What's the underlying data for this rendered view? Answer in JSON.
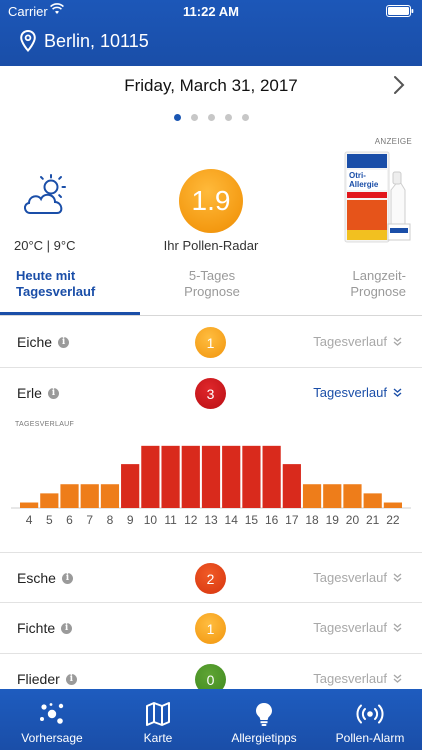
{
  "status_bar": {
    "carrier": "Carrier",
    "time": "11:22 AM"
  },
  "location": {
    "label": "Berlin, 10115"
  },
  "date": {
    "label": "Friday, March 31, 2017",
    "page_dots": 5,
    "active_dot": 0
  },
  "weather": {
    "temperature": "20°C | 9°C",
    "icon": "partly-cloudy-icon"
  },
  "radar": {
    "value": "1.9",
    "label": "Ihr Pollen-Radar"
  },
  "ad": {
    "label": "ANZEIGE",
    "product": "Otri-Allergie"
  },
  "tabs": [
    {
      "line1": "Heute mit",
      "line2": "Tagesverlauf",
      "active": true
    },
    {
      "line1": "5-Tages",
      "line2": "Prognose",
      "active": false
    },
    {
      "line1": "Langzeit-",
      "line2": "Prognose",
      "active": false
    }
  ],
  "pollen": [
    {
      "name": "Eiche",
      "level": "1",
      "link": "Tagesverlauf"
    },
    {
      "name": "Erle",
      "level": "3",
      "link": "Tagesverlauf"
    },
    {
      "name": "Esche",
      "level": "2",
      "link": "Tagesverlauf"
    },
    {
      "name": "Fichte",
      "level": "1",
      "link": "Tagesverlauf"
    },
    {
      "name": "Flieder",
      "level": "0",
      "link": "Tagesverlauf"
    }
  ],
  "chart_data": {
    "type": "bar",
    "title": "TAGESVERLAUF",
    "categories": [
      "4",
      "5",
      "6",
      "7",
      "8",
      "9",
      "10",
      "11",
      "12",
      "13",
      "14",
      "15",
      "16",
      "17",
      "18",
      "19",
      "20",
      "21",
      "22"
    ],
    "values": [
      0.3,
      0.8,
      1.3,
      1.3,
      1.3,
      2.4,
      3.4,
      3.4,
      3.4,
      3.4,
      3.4,
      3.4,
      3.4,
      2.4,
      1.3,
      1.3,
      1.3,
      0.8,
      0.3
    ],
    "colors": [
      "#ee7d1a",
      "#ee7d1a",
      "#ee7d1a",
      "#ee7d1a",
      "#ee7d1a",
      "#d92a1c",
      "#d92a1c",
      "#d92a1c",
      "#d92a1c",
      "#d92a1c",
      "#d92a1c",
      "#d92a1c",
      "#d92a1c",
      "#d92a1c",
      "#ee7d1a",
      "#ee7d1a",
      "#ee7d1a",
      "#ee7d1a",
      "#ee7d1a"
    ],
    "ylim": [
      0,
      3.5
    ]
  },
  "nav": [
    {
      "label": "Vorhersage",
      "icon": "forecast-icon"
    },
    {
      "label": "Karte",
      "icon": "map-icon"
    },
    {
      "label": "Allergietipps",
      "icon": "lightbulb-icon"
    },
    {
      "label": "Pollen-Alarm",
      "icon": "broadcast-icon"
    }
  ],
  "colors": {
    "brand_blue": "#1a4ea8",
    "orange": "#f49a12",
    "red": "#c8161b",
    "green": "#4a9a28"
  }
}
